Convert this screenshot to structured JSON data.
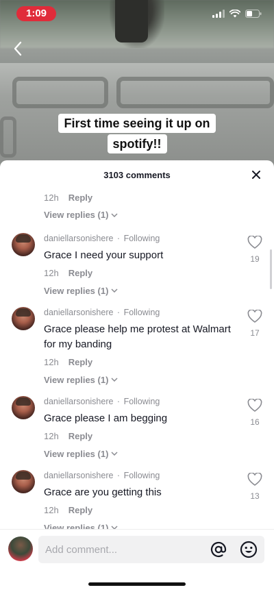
{
  "status_bar": {
    "time": "1:09"
  },
  "video": {
    "caption_line1": "First time seeing it up on",
    "caption_line2": "spotify!!"
  },
  "comments_panel": {
    "count_label": "3103 comments",
    "top_fragment": {
      "age": "12h",
      "reply_label": "Reply",
      "view_replies": "View replies (1)"
    },
    "comments": [
      {
        "username": "daniellarsonishere",
        "relationship": "Following",
        "text": "Grace I need your support",
        "age": "12h",
        "reply_label": "Reply",
        "view_replies": "View replies (1)",
        "likes": "19"
      },
      {
        "username": "daniellarsonishere",
        "relationship": "Following",
        "text": "Grace please help me protest at Walmart for my banding",
        "age": "12h",
        "reply_label": "Reply",
        "view_replies": "View replies (1)",
        "likes": "17"
      },
      {
        "username": "daniellarsonishere",
        "relationship": "Following",
        "text": "Grace please I am begging",
        "age": "12h",
        "reply_label": "Reply",
        "view_replies": "View replies (1)",
        "likes": "16"
      },
      {
        "username": "daniellarsonishere",
        "relationship": "Following",
        "text": "Grace are you getting this",
        "age": "12h",
        "reply_label": "Reply",
        "view_replies": "View replies (1)",
        "likes": "13"
      }
    ],
    "composer": {
      "placeholder": "Add comment..."
    }
  },
  "icons": {
    "back": "chevron-left-icon",
    "close": "close-icon",
    "like": "heart-outline-icon",
    "expand": "chevron-down-icon",
    "mention": "at-sign-icon",
    "emoji": "smiley-icon"
  },
  "colors": {
    "time_pill": "#e02c3a",
    "muted_text": "#8a8b91",
    "primary_text": "#161823"
  }
}
